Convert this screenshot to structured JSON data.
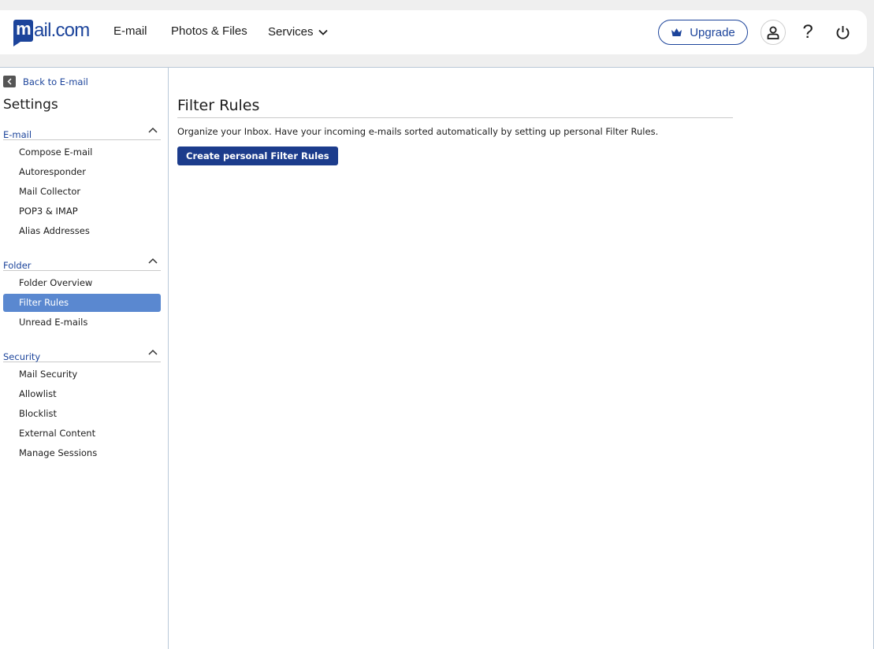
{
  "brand": {
    "logo_initial": "m",
    "logo_rest": "ail.com",
    "accent": "#1c449b"
  },
  "topnav": {
    "email": "E-mail",
    "photos_files": "Photos & Files",
    "services": "Services",
    "upgrade": "Upgrade",
    "help": "?"
  },
  "sidebar": {
    "back": "Back to E-mail",
    "title": "Settings",
    "sections": [
      {
        "label": "E-mail",
        "items": [
          "Compose E-mail",
          "Autoresponder",
          "Mail Collector",
          "POP3 & IMAP",
          "Alias Addresses"
        ]
      },
      {
        "label": "Folder",
        "items": [
          "Folder Overview",
          "Filter Rules",
          "Unread E-mails"
        ]
      },
      {
        "label": "Security",
        "items": [
          "Mail Security",
          "Allowlist",
          "Blocklist",
          "External Content",
          "Manage Sessions"
        ]
      }
    ],
    "active_item": "Filter Rules",
    "active_color": "#5a88d0"
  },
  "main": {
    "title": "Filter Rules",
    "intro": "Organize your Inbox. Have your incoming e-mails sorted automatically by setting up personal Filter Rules.",
    "create_button": "Create personal Filter Rules"
  },
  "icons": {
    "upgrade": "crown-icon",
    "profile": "user-icon",
    "help": "help-icon",
    "logout": "power-icon",
    "back": "chevron-left-icon",
    "section_toggle": "chevron-up-icon",
    "services_dropdown": "chevron-down-icon"
  }
}
